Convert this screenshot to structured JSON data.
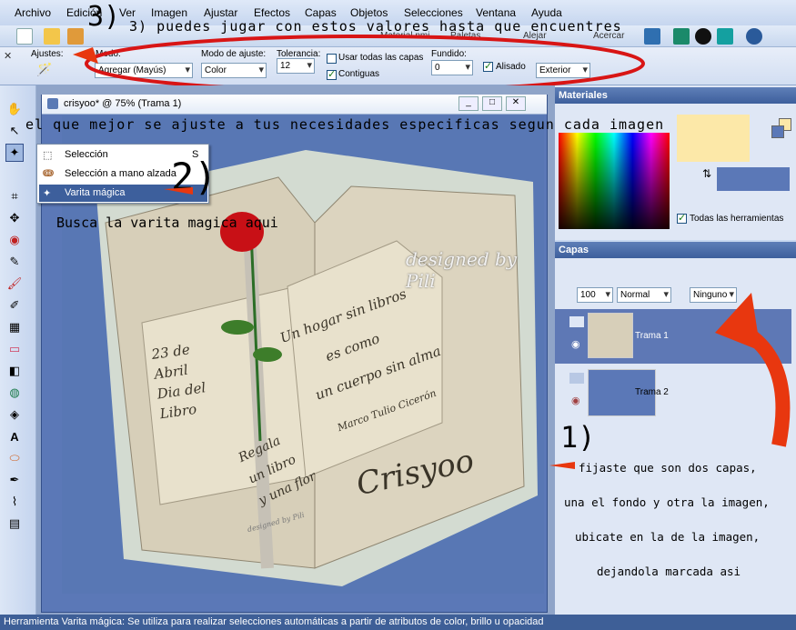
{
  "menubar": {
    "items": [
      "Archivo",
      "Edición",
      "Ver",
      "Imagen",
      "Ajustar",
      "Efectos",
      "Capas",
      "Objetos",
      "Selecciones",
      "Ventana",
      "Ayuda"
    ]
  },
  "toolbar": {
    "right_labels": [
      "Material nmi",
      "Paletas",
      "Alejar",
      "Acercar"
    ]
  },
  "options": {
    "ajustes_label": "Ajustes:",
    "modo_label": "Modo:",
    "modo_value": "Agregar (Mayús)",
    "modo_ajuste_label": "Modo de ajuste:",
    "modo_ajuste_value": "Color",
    "tolerancia_label": "Tolerancia:",
    "tolerancia_value": "12",
    "usar_todas": "Usar todas las capas",
    "contiguas": "Contiguas",
    "fundido_label": "Fundido:",
    "fundido_value": "0",
    "alisado": "Alisado",
    "exterior_value": "Exterior"
  },
  "image_window": {
    "title": "crisyoo* @ 75% (Trama 1)"
  },
  "tool_menu": {
    "items": [
      {
        "label": "Selección",
        "shortcut": "S"
      },
      {
        "label": "Selección a mano alzada",
        "shortcut": ""
      },
      {
        "label": "Varita mágica",
        "shortcut": ""
      }
    ]
  },
  "book": {
    "left_text": [
      "23 de",
      "Abril",
      "Dia del",
      "Libro"
    ],
    "right_text": [
      "Un hogar sin libros",
      "es como",
      "un cuerpo sin alma"
    ],
    "author": "Marco Tulio Cicerón",
    "bottom_left": [
      "Regala",
      "un libro",
      "y una flor"
    ],
    "signature": "Crisyoo",
    "watermark": "designed by Pili",
    "small_watermark": "designed by Pili"
  },
  "materials": {
    "title": "Materiales",
    "all_tools": "Todas las herramientas"
  },
  "layers": {
    "title": "Capas",
    "opacity": "100",
    "blend": "Normal",
    "mask": "Ninguno",
    "items": [
      {
        "name": "Trama 1"
      },
      {
        "name": "Trama 2"
      }
    ]
  },
  "annotations": {
    "step3_line1": "3) puedes jugar con estos valores hasta que encuentres",
    "step3_line2": "el que mejor se ajuste a tus necesidades especificas segun cada imagen",
    "step2_number": "2)",
    "step2_text": "Busca la varita magica aqui",
    "step1_number": "1)",
    "step1_lines": [
      "fijaste que son dos capas,",
      "una el fondo y otra la imagen,",
      "ubicate en la de la imagen,",
      "dejandola marcada asi"
    ]
  },
  "status": {
    "text": "Herramienta Varita mágica: Se utiliza para realizar selecciones automáticas a partir de atributos de color, brillo u opacidad"
  },
  "colors": {
    "accent_red": "#e8370f",
    "panel_blue": "#3d5f9c",
    "canvas_blue": "#5b78b7",
    "swatch_cream": "#fce8a8",
    "swatch_blue": "#5b78b7"
  }
}
